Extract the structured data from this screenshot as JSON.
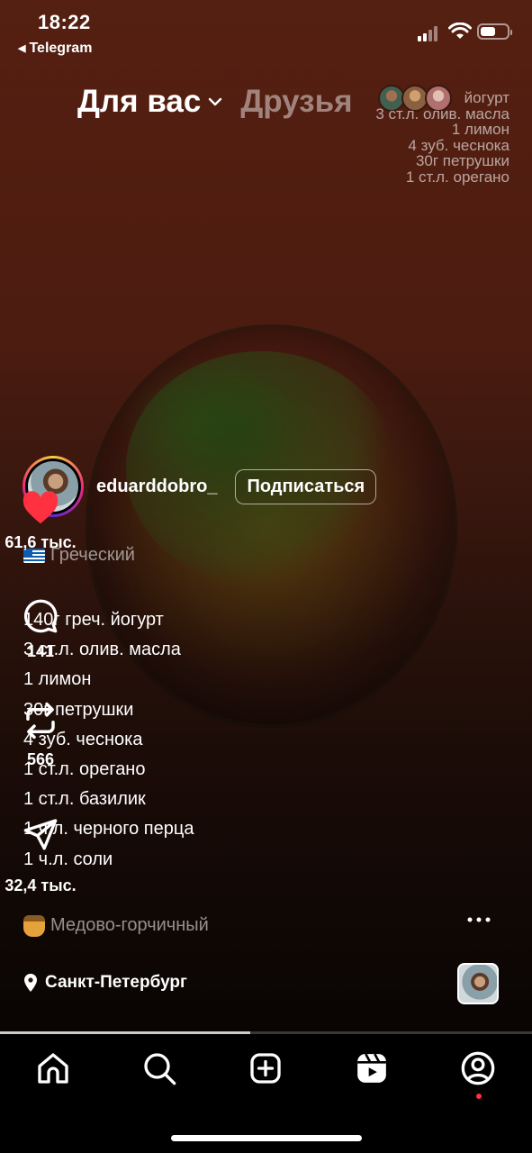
{
  "status_bar": {
    "time": "18:22",
    "back_app": "Telegram",
    "battery_level": 0.62
  },
  "top_tabs": {
    "active": "Для вас",
    "other": "Друзья"
  },
  "overlay_recipe": [
    "йогурт",
    "3 ст.л. олив. масла",
    "1 лимон",
    "4 зуб. чеснока",
    "30г петрушки",
    "1 ст.л. орегано"
  ],
  "post": {
    "username": "eduarddobro_",
    "follow_label": "Подписаться",
    "section1_title": "Греческий",
    "ingredients": [
      "140г греч. йогурт",
      "3 ст.л. олив. масла",
      "1 лимон",
      "30г петрушки",
      "4 зуб. чеснока",
      "1 ст.л. орегано",
      "1 ст.л. базилик",
      "1 ч.л. черного перца",
      "1 ч.л. соли"
    ],
    "section2_title": "Медово-горчичный",
    "location": "Санкт-Петербург"
  },
  "actions": {
    "likes": "61,6 тыс.",
    "comments": "141",
    "reposts": "566",
    "shares": "32,4 тыс."
  },
  "playback_progress": 0.47,
  "colors": {
    "like": "#ff3040",
    "accent_dot": "#ff3040",
    "nav_bg": "#000000"
  },
  "icons": {
    "like": "heart-filled-icon",
    "comment": "comment-bubble-icon",
    "repost": "repost-icon",
    "share": "send-icon",
    "more": "more-dots-icon",
    "home": "home-icon",
    "search": "search-icon",
    "create": "add-icon",
    "reels": "reels-icon",
    "profile": "profile-icon"
  }
}
